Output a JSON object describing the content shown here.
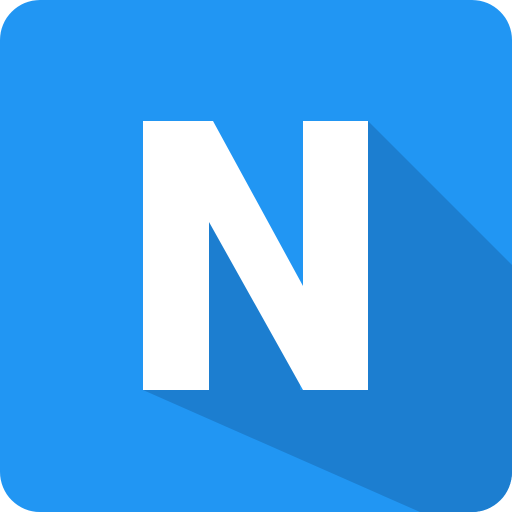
{
  "app_icon": {
    "letter": "N",
    "colors": {
      "background": "#2196F3",
      "long_shadow": "#1C7ED0",
      "letter": "#FFFFFF"
    }
  }
}
